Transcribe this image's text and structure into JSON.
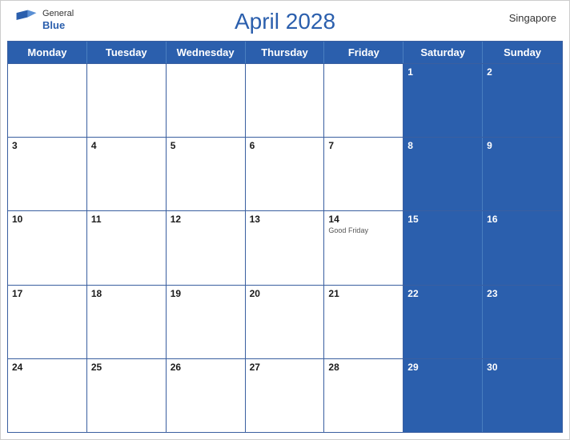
{
  "header": {
    "title": "April 2028",
    "country": "Singapore",
    "logo_general": "General",
    "logo_blue": "Blue"
  },
  "days": [
    "Monday",
    "Tuesday",
    "Wednesday",
    "Thursday",
    "Friday",
    "Saturday",
    "Sunday"
  ],
  "weeks": [
    [
      {
        "num": "",
        "empty": true
      },
      {
        "num": "",
        "empty": true
      },
      {
        "num": "",
        "empty": true
      },
      {
        "num": "",
        "empty": true
      },
      {
        "num": "",
        "empty": true
      },
      {
        "num": "1",
        "header": true
      },
      {
        "num": "2",
        "header": true
      }
    ],
    [
      {
        "num": "3"
      },
      {
        "num": "4"
      },
      {
        "num": "5"
      },
      {
        "num": "6"
      },
      {
        "num": "7"
      },
      {
        "num": "8",
        "header": true
      },
      {
        "num": "9",
        "header": true
      }
    ],
    [
      {
        "num": "10"
      },
      {
        "num": "11"
      },
      {
        "num": "12"
      },
      {
        "num": "13"
      },
      {
        "num": "14",
        "holiday": "Good Friday"
      },
      {
        "num": "15",
        "header": true
      },
      {
        "num": "16",
        "header": true
      }
    ],
    [
      {
        "num": "17"
      },
      {
        "num": "18"
      },
      {
        "num": "19"
      },
      {
        "num": "20"
      },
      {
        "num": "21"
      },
      {
        "num": "22",
        "header": true
      },
      {
        "num": "23",
        "header": true
      }
    ],
    [
      {
        "num": "24"
      },
      {
        "num": "25"
      },
      {
        "num": "26"
      },
      {
        "num": "27"
      },
      {
        "num": "28"
      },
      {
        "num": "29",
        "header": true
      },
      {
        "num": "30",
        "header": true
      }
    ]
  ]
}
